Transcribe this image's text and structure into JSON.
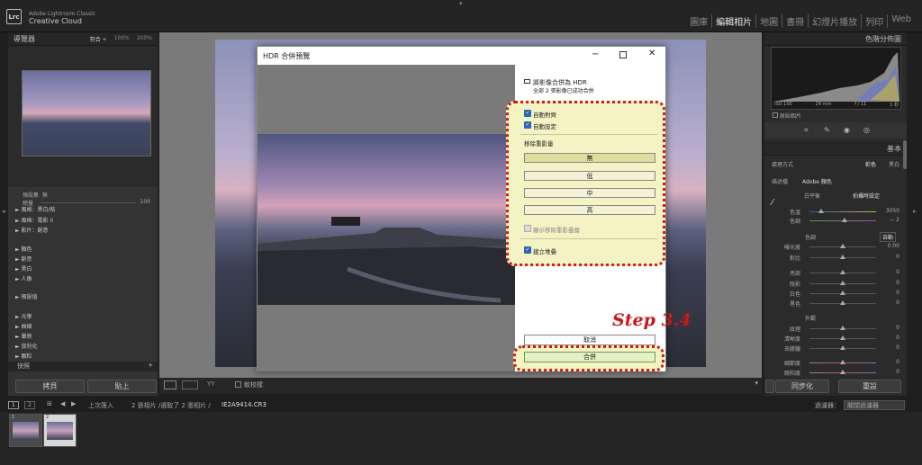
{
  "app": {
    "brand_line1": "Adobe Lightroom Classic",
    "brand_line2": "Creative Cloud",
    "logo": "Lrc"
  },
  "modules": [
    "圖庫",
    "編輯相片",
    "地圖",
    "書冊",
    "幻燈片播放",
    "列印",
    "Web"
  ],
  "left_panel": {
    "navigator_title": "導覽器",
    "zoom_options": [
      "符合 ÷",
      "100%",
      "200%"
    ],
    "preset_label": "預設集",
    "preset_value": "無",
    "amount_label": "總量",
    "amount_value": "100",
    "items": [
      "► 風格：黑白/粘",
      "► 風格：電影 II",
      "► 影片：創意",
      "► 顏色",
      "► 創意",
      "► 黑白",
      "► 人像",
      "► 預設值",
      "► 光學",
      "► 曲線",
      "► 暈映",
      "► 我利化",
      "► 顆粒"
    ],
    "snapshots_title": "快照",
    "copy_button": "拷貝",
    "paste_button": "貼上"
  },
  "toolbar": {
    "before_after": "YY",
    "soft_proof": "軟校樣"
  },
  "right_panel": {
    "histogram_title": "色階分佈圖",
    "iso": "ISO 100",
    "focal": "24 mm",
    "aperture": "f / 11",
    "shutter": "1 秒",
    "original_photo": "原始相片",
    "basic_title": "基本",
    "treatment_label": "處理方式",
    "treatment_color": "彩色",
    "treatment_bw": "黑白",
    "profile_label": "描述檔",
    "profile_value": "Adobe 顏色",
    "wb_label": "白平衡",
    "wb_value": "拍攝時設定",
    "temp_label": "色溫",
    "temp_value": "3050",
    "tint_label": "色調",
    "tint_value": "− 2",
    "tone_label": "色調",
    "auto_label": "自動",
    "exposure_label": "曝光度",
    "exposure_value": "0.00",
    "contrast_label": "對比",
    "contrast_value": "0",
    "highlights_label": "亮部",
    "highlights_value": "0",
    "shadows_label": "陰影",
    "shadows_value": "0",
    "whites_label": "白色",
    "whites_value": "0",
    "blacks_label": "黑色",
    "blacks_value": "0",
    "presence_label": "外觀",
    "texture_label": "紋理",
    "texture_value": "0",
    "clarity_label": "清晰度",
    "clarity_value": "0",
    "dehaze_label": "去朦朧",
    "dehaze_value": "0",
    "vibrance_label": "細節度",
    "vibrance_value": "0",
    "saturation_label": "飽和度",
    "saturation_value": "0",
    "sync_button": "同步化",
    "reset_button": "重設"
  },
  "filmstrip": {
    "pages": [
      "1",
      "2"
    ],
    "last_import": "上次匯入",
    "count_info": "2 張相片 /選取了 2 張相片 /",
    "filename": "IE2A9414.CR3",
    "filter_label": "過濾器：",
    "filter_value": "關閉過濾器",
    "thumb_numbers": [
      "1",
      "2"
    ]
  },
  "dialog": {
    "title": "HDR 合併預覽",
    "status_title": "將影像合併為 HDR",
    "status_sub": "全部 2 張影像已成功合併",
    "auto_align": "自動對齊",
    "auto_settings": "自動設定",
    "deghost_title": "移除重影量",
    "deghost_options": [
      "無",
      "低",
      "中",
      "高"
    ],
    "show_overlay": "顯示移除重影疊層",
    "create_stack": "建立堆疊",
    "cancel_button": "取消",
    "merge_button": "合併"
  },
  "annotation": {
    "step_label": "Step 3.4",
    "highlight_color": "#d01c1c"
  }
}
